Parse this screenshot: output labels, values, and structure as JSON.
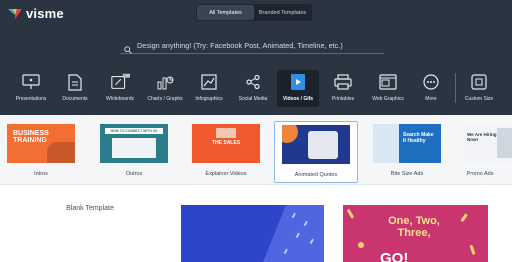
{
  "app": {
    "logo_text": "visme"
  },
  "tabs": {
    "all": "All Templates",
    "branded": "Branded Templates"
  },
  "search": {
    "placeholder": "Design anything! (Try: Facebook Post, Animated, Timeline, etc.)"
  },
  "categories": [
    {
      "label": "Presentations",
      "icon": "presentation-icon"
    },
    {
      "label": "Documents",
      "icon": "document-icon"
    },
    {
      "label": "Whiteboards",
      "icon": "whiteboard-icon",
      "badge": "BETA"
    },
    {
      "label": "Charts / Graphs",
      "icon": "chart-icon"
    },
    {
      "label": "Infographics",
      "icon": "infographic-icon"
    },
    {
      "label": "Social Media",
      "icon": "social-media-icon"
    },
    {
      "label": "Videos / Gifs",
      "icon": "video-icon",
      "active": true
    },
    {
      "label": "Printables",
      "icon": "printer-icon"
    },
    {
      "label": "Web Graphics",
      "icon": "web-graphics-icon"
    },
    {
      "label": "More",
      "icon": "more-icon"
    },
    {
      "label": "Custom Size",
      "icon": "custom-size-icon"
    }
  ],
  "subcategories": [
    {
      "label": "Intros",
      "thumb_text": "BUSINESS TRAINING"
    },
    {
      "label": "Outros",
      "thumb_text": "HOW TO CONNECT WITH US"
    },
    {
      "label": "Explainer Videos",
      "thumb_text": "THE SALES"
    },
    {
      "label": "Animated Quotes",
      "selected": true
    },
    {
      "label": "Bite Size Ads",
      "thumb_text": "Search Make It Healthy"
    },
    {
      "label": "Promo Ads",
      "thumb_text": "We Are Hiring Now!"
    }
  ],
  "templates": {
    "blank_label": "Blank Template",
    "card2_text": "One, Two, Three,",
    "card2_go": "GO!"
  },
  "colors": {
    "header_bg": "#2b3441",
    "accent_selected": "#8fb8ea"
  }
}
